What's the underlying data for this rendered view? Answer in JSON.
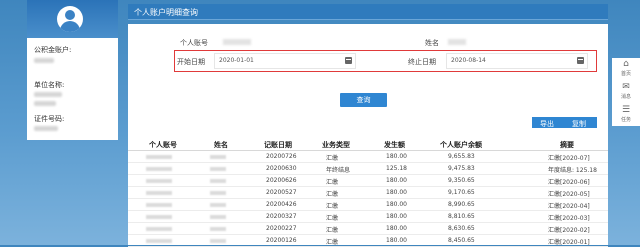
{
  "sidebar": {
    "account_label": "公积金账户:",
    "company_label": "单位名称:",
    "id_label": "证件号码:"
  },
  "header": {
    "title": "个人账户明细查询"
  },
  "form": {
    "account_label": "个人账号",
    "name_label": "姓名",
    "start_label": "开始日期",
    "start_value": "2020-01-01",
    "end_label": "终止日期",
    "end_value": "2020-08-14",
    "query_button": "查询"
  },
  "toolbar": {
    "export": "导出",
    "copy": "复制"
  },
  "table": {
    "headers": [
      "个人账号",
      "姓名",
      "记账日期",
      "业务类型",
      "发生额",
      "个人账户余额",
      "摘要"
    ],
    "rows": [
      {
        "date": "20200726",
        "type": "汇缴",
        "amount": "180.00",
        "balance": "9,655.83",
        "summary": "汇缴[2020-07]"
      },
      {
        "date": "20200630",
        "type": "年终结息",
        "amount": "125.18",
        "balance": "9,475.83",
        "summary": "年度结息: 125.18"
      },
      {
        "date": "20200626",
        "type": "汇缴",
        "amount": "180.00",
        "balance": "9,350.65",
        "summary": "汇缴[2020-06]"
      },
      {
        "date": "20200527",
        "type": "汇缴",
        "amount": "180.00",
        "balance": "9,170.65",
        "summary": "汇缴[2020-05]"
      },
      {
        "date": "20200426",
        "type": "汇缴",
        "amount": "180.00",
        "balance": "8,990.65",
        "summary": "汇缴[2020-04]"
      },
      {
        "date": "20200327",
        "type": "汇缴",
        "amount": "180.00",
        "balance": "8,810.65",
        "summary": "汇缴[2020-03]"
      },
      {
        "date": "20200227",
        "type": "汇缴",
        "amount": "180.00",
        "balance": "8,630.65",
        "summary": "汇缴[2020-02]"
      },
      {
        "date": "20200126",
        "type": "汇缴",
        "amount": "180.00",
        "balance": "8,450.65",
        "summary": "汇缴[2020-01]"
      }
    ]
  },
  "side": {
    "home": "首页",
    "msg": "消息",
    "task": "任务"
  }
}
